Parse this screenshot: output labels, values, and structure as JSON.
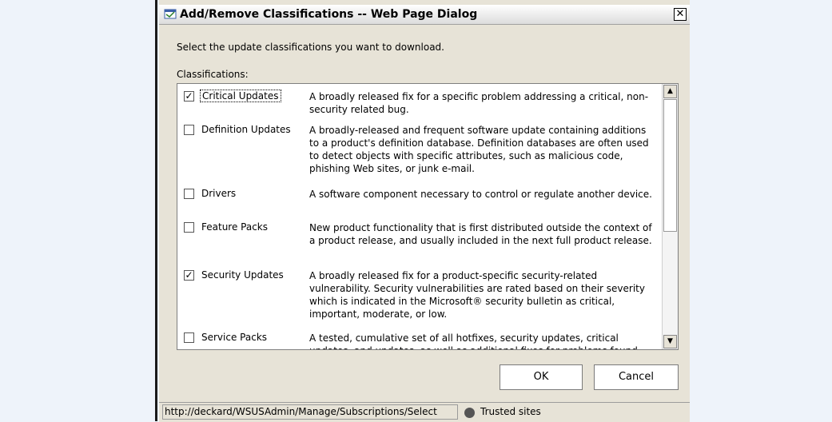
{
  "window": {
    "title": "Add/Remove Classifications -- Web Page Dialog",
    "close_label": "✕"
  },
  "instruction": "Select the update classifications you want to download.",
  "classifications_label": "Classifications:",
  "classifications": [
    {
      "name": "Critical Updates",
      "checked": true,
      "description": "A broadly released fix for a specific problem addressing a critical, non-security related bug."
    },
    {
      "name": "Definition Updates",
      "checked": false,
      "description": "A broadly-released and frequent software update containing additions to a product's definition database. Definition databases are often used to detect objects with specific attributes, such as malicious code, phishing Web sites, or junk e-mail."
    },
    {
      "name": "Drivers",
      "checked": false,
      "description": "A software component necessary to control or regulate another device."
    },
    {
      "name": "Feature Packs",
      "checked": false,
      "description": "New product functionality that is first distributed outside the context of a product release, and usually included in the next full product release."
    },
    {
      "name": "Security Updates",
      "checked": true,
      "description": "A broadly released fix for a product-specific security-related vulnerability. Security vulnerabilities are rated based on their severity which is indicated in the Microsoft® security bulletin as critical, important, moderate, or low."
    },
    {
      "name": "Service Packs",
      "checked": false,
      "description": "A tested, cumulative set of all hotfixes, security updates, critical updates, and updates, as well as additional fixes for problems found"
    }
  ],
  "buttons": {
    "ok": "OK",
    "cancel": "Cancel"
  },
  "statusbar": {
    "url": "http://deckard/WSUSAdmin/Manage/Subscriptions/Select",
    "zone": "Trusted sites"
  }
}
